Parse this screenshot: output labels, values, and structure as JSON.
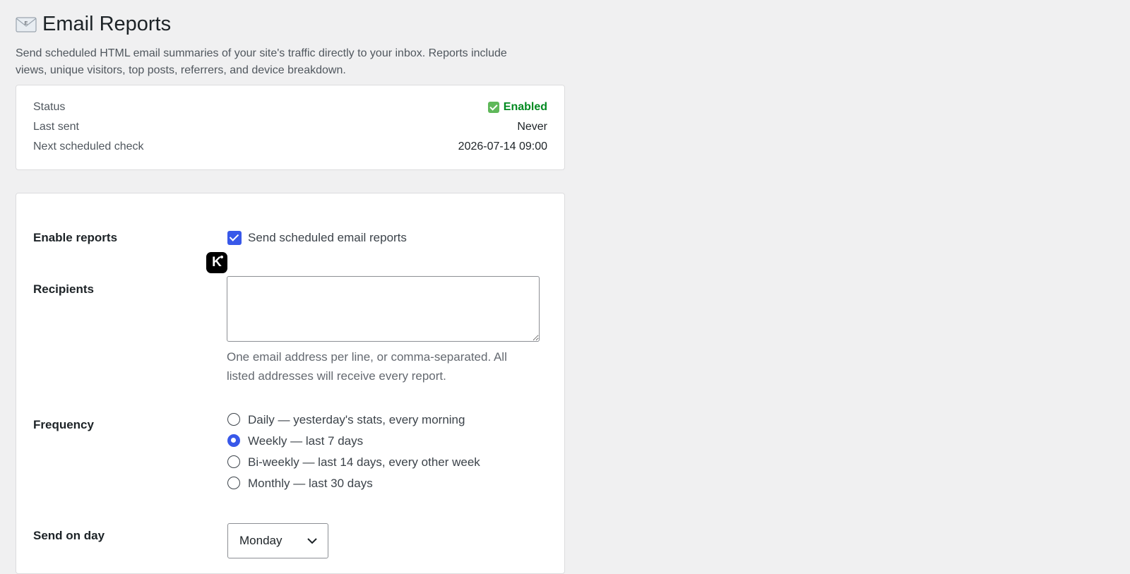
{
  "header": {
    "title": "Email Reports",
    "title_icon": "envelope-icon",
    "intro": "Send scheduled HTML email summaries of your site's traffic directly to your inbox. Reports include views, unique visitors, top posts, referrers, and device breakdown."
  },
  "status": {
    "rows": [
      {
        "label": "Status",
        "value": "Enabled"
      },
      {
        "label": "Last sent",
        "value": "Never"
      },
      {
        "label": "Next scheduled check",
        "value": "2026-07-14 09:00"
      }
    ],
    "enabled_color": "#008a20"
  },
  "settings": {
    "enable": {
      "label": "Enable reports",
      "checkbox_label": "Send scheduled email reports",
      "checked": true
    },
    "extension_badge": "K",
    "recipients": {
      "label": "Recipients",
      "value": "",
      "help": "One email address per line, or comma-separated. All listed addresses will receive every report."
    },
    "frequency": {
      "label": "Frequency",
      "options": [
        {
          "label": "Daily — yesterday's stats, every morning",
          "selected": false
        },
        {
          "label": "Weekly — last 7 days",
          "selected": true
        },
        {
          "label": "Bi-weekly — last 14 days, every other week",
          "selected": false
        },
        {
          "label": "Monthly — last 30 days",
          "selected": false
        }
      ]
    },
    "send_day": {
      "label": "Send on day",
      "value": "Monday"
    }
  },
  "colors": {
    "accent": "#3858e9",
    "background": "#f0f0f1"
  }
}
